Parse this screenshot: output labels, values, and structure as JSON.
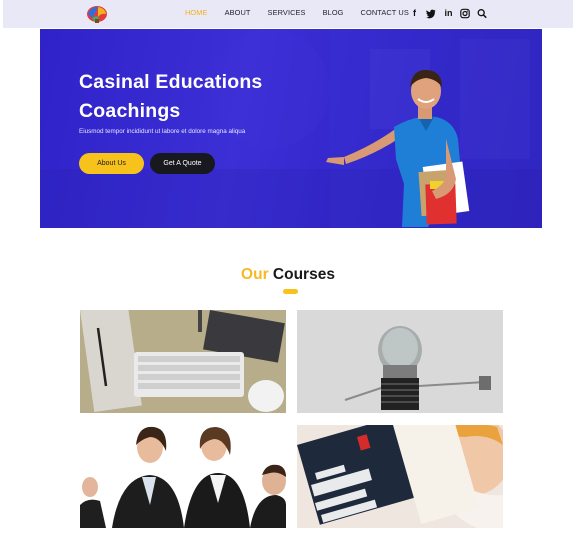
{
  "nav": {
    "items": [
      {
        "label": "HOME",
        "active": true
      },
      {
        "label": "ABOUT"
      },
      {
        "label": "SERVICES"
      },
      {
        "label": "BLOG"
      },
      {
        "label": "CONTACT US"
      }
    ],
    "social_icons": [
      "facebook-icon",
      "twitter-icon",
      "linkedin-icon",
      "instagram-icon",
      "search-icon"
    ]
  },
  "hero": {
    "title_line1": "Casinal Educations",
    "title_line2": "Coachings",
    "subtitle": "Eiusmod tempor incididunt ut labore et dolore magna aliqua",
    "about_button": "About Us",
    "quote_button": "Get A Quote"
  },
  "courses": {
    "heading_accent": "Our",
    "heading_rest": "Courses"
  },
  "colors": {
    "accent": "#f7c21c",
    "hero_blue": "#3126c8",
    "dark_button": "#18181f",
    "nav_bg": "#e8e8f6"
  }
}
